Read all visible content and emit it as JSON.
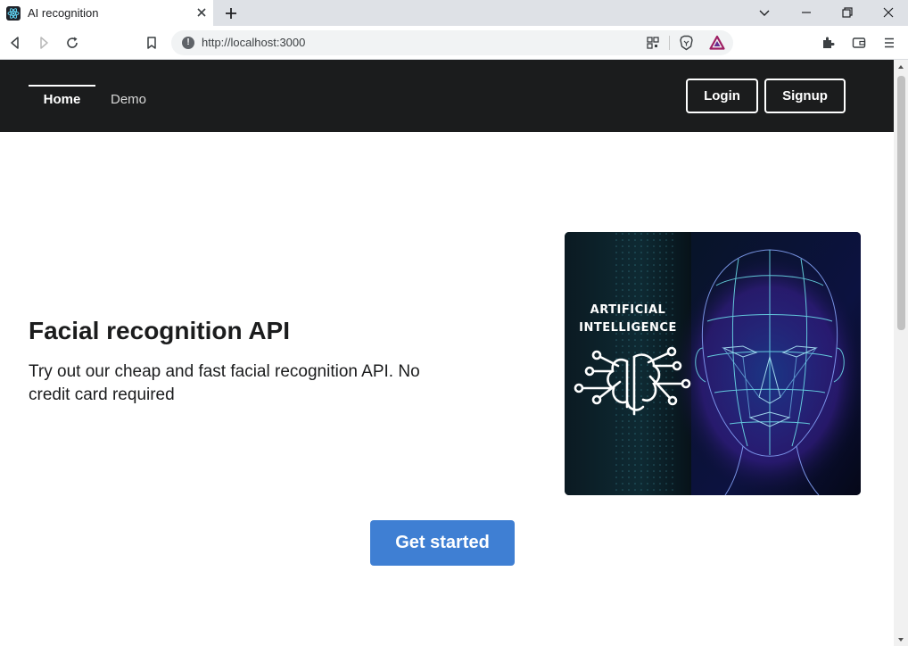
{
  "browser": {
    "tab_title": "AI recognition",
    "url": "http://localhost:3000"
  },
  "nav": {
    "items": [
      {
        "label": "Home",
        "active": true
      },
      {
        "label": "Demo",
        "active": false
      }
    ],
    "login_label": "Login",
    "signup_label": "Signup"
  },
  "hero": {
    "title": "Facial recognition API",
    "description": "Try out our cheap and fast facial recognition API. No credit card required",
    "image_caption_line1": "ARTIFICIAL",
    "image_caption_line2": "INTELLIGENCE",
    "cta_label": "Get started"
  },
  "colors": {
    "navbar": "#1b1c1d",
    "cta": "#3f7fd3",
    "text": "#1b1c1d"
  },
  "icons": [
    "react-favicon-icon",
    "close-icon",
    "plus-icon",
    "chevron-down-icon",
    "minimize-icon",
    "restore-icon",
    "back-icon",
    "forward-icon",
    "reload-icon",
    "bookmark-icon",
    "info-icon",
    "qr-code-icon",
    "brave-shield-icon",
    "bat-rewards-icon",
    "extensions-icon",
    "wallet-icon",
    "menu-icon",
    "brain-circuit-icon"
  ]
}
